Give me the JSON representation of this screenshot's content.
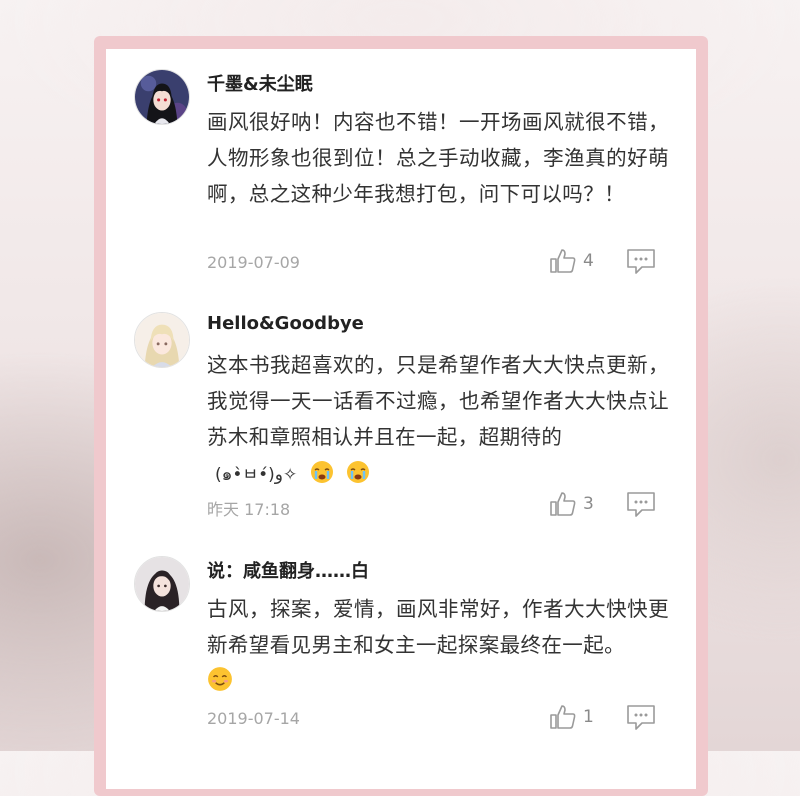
{
  "comments": [
    {
      "username": "千墨&未尘眠",
      "text": "画风很好呐！内容也不错！一开场画风就很不错，人物形象也很到位！总之手动收藏，李渔真的好萌啊，总之这种少年我想打包，问下可以吗？！",
      "timestamp": "2019-07-09",
      "likes": "4"
    },
    {
      "username": "Hello&Goodbye",
      "text": "这本书我超喜欢的，只是希望作者大大快点更新，我觉得一天一话看不过瘾，也希望作者大大快点让苏木和章照相认并且在一起，超期待的",
      "kaomoji": "(๑•̀ㅂ•́)و✧",
      "timestamp": "昨天 17:18",
      "likes": "3"
    },
    {
      "username": "说：咸鱼翻身……白",
      "text": "古风，探案，爱情，画风非常好，作者大大快快更新希望看见男主和女主一起探案最终在一起。",
      "timestamp": "2019-07-14",
      "likes": "1"
    }
  ],
  "icons": {
    "like": "thumbs-up-outline-icon",
    "reply": "comment-bubble-icon",
    "crying": "crying-face-emoji",
    "smiling": "smiling-face-emoji"
  },
  "colors": {
    "frame": "#f0c9cd",
    "card": "#ffffff",
    "text": "#333333",
    "meta": "#a6a6a6"
  }
}
